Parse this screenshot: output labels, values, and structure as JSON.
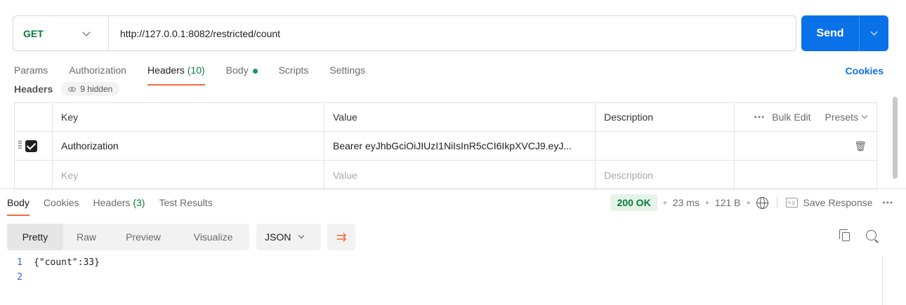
{
  "request": {
    "method": "GET",
    "url": "http://127.0.0.1:8082/restricted/count",
    "send_label": "Send"
  },
  "request_tabs": [
    {
      "label": "Params"
    },
    {
      "label": "Authorization"
    },
    {
      "label": "Headers",
      "count": "(10)"
    },
    {
      "label": "Body"
    },
    {
      "label": "Scripts"
    },
    {
      "label": "Settings"
    }
  ],
  "cookies_link": "Cookies",
  "headers_section": {
    "title": "Headers",
    "hidden_label": "9 hidden",
    "columns": {
      "key": "Key",
      "value": "Value",
      "description": "Description"
    },
    "bulk_edit": "Bulk Edit",
    "presets": "Presets",
    "rows": [
      {
        "key": "Authorization",
        "value": "Bearer eyJhbGciOiJIUzI1NiIsInR5cCI6IkpXVCJ9.eyJ...",
        "description": "",
        "checked": true
      }
    ],
    "placeholder": {
      "key": "Key",
      "value": "Value",
      "description": "Description"
    }
  },
  "response_tabs": [
    {
      "label": "Body"
    },
    {
      "label": "Cookies"
    },
    {
      "label": "Headers",
      "count": "(3)"
    },
    {
      "label": "Test Results"
    }
  ],
  "response_status": {
    "status": "200 OK",
    "time": "23 ms",
    "size": "121 B",
    "save_response": "Save Response"
  },
  "format_options": [
    "Pretty",
    "Raw",
    "Preview",
    "Visualize"
  ],
  "language": "JSON",
  "code_lines": [
    {
      "n": "1",
      "text": "{\"count\":33}"
    },
    {
      "n": "2",
      "text": ""
    }
  ],
  "colors": {
    "accent": "#0a72e8",
    "tab_underline": "#f26b3a",
    "method_green": "#0b7a3b"
  }
}
